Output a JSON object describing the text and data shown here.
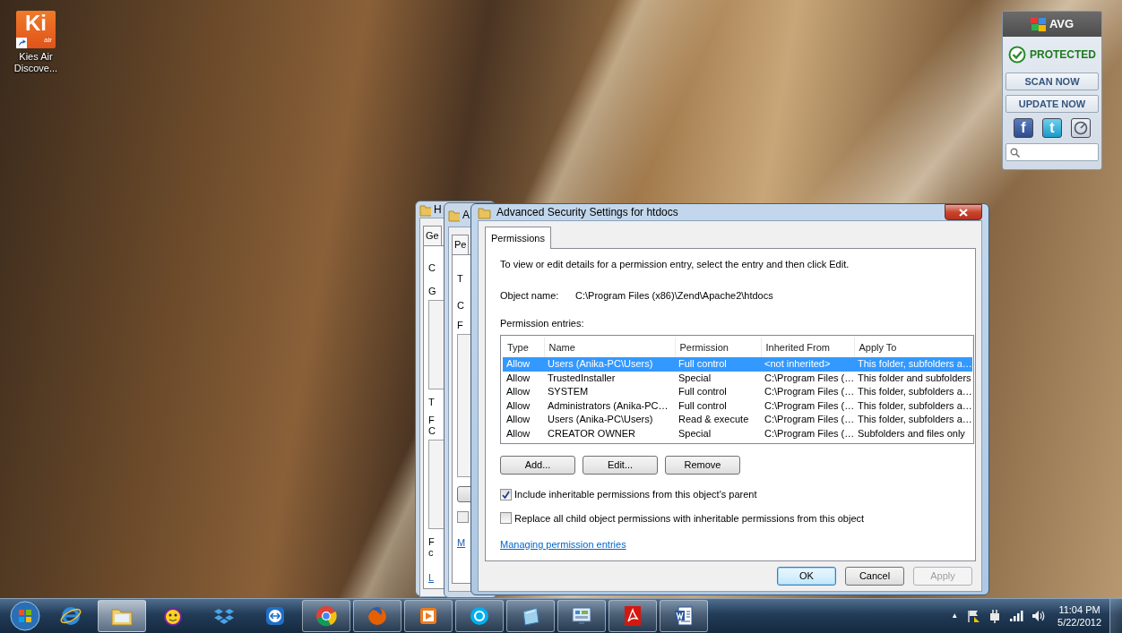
{
  "desktop_icons": [
    {
      "logo": "Ki",
      "logo_sub": "air",
      "label": "Kies Air Discove..."
    }
  ],
  "background_windows": [
    {
      "title": "H",
      "tab": "Ge",
      "lines": [
        {
          "kind": "text",
          "text": "C"
        },
        {
          "kind": "text",
          "text": "G"
        },
        {
          "kind": "listbox"
        },
        {
          "kind": "text",
          "text": "T"
        },
        {
          "kind": "text",
          "text": "F"
        },
        {
          "kind": "text",
          "text": "C"
        },
        {
          "kind": "listbox"
        },
        {
          "kind": "text",
          "text": "F"
        },
        {
          "kind": "text",
          "text": "c"
        },
        {
          "kind": "link",
          "text": "L"
        }
      ]
    },
    {
      "title": "A",
      "tab": "Pe",
      "lines": [
        {
          "kind": "text",
          "text": "T"
        },
        {
          "kind": "text",
          "text": "C"
        },
        {
          "kind": "text",
          "text": "F"
        },
        {
          "kind": "listbox"
        },
        {
          "kind": "button"
        },
        {
          "kind": "checkbox",
          "checked": false
        },
        {
          "kind": "link",
          "text": "M"
        }
      ]
    }
  ],
  "dialog": {
    "title": "Advanced Security Settings for htdocs",
    "tabs": [
      {
        "label": "Permissions",
        "selected": true
      }
    ],
    "instructions": "To view or edit details for a permission entry, select the entry and then click Edit.",
    "object_name_label": "Object name:",
    "object_name": "C:\\Program Files (x86)\\Zend\\Apache2\\htdocs",
    "entries_label": "Permission entries:",
    "columns": [
      "Type",
      "Name",
      "Permission",
      "Inherited From",
      "Apply To"
    ],
    "rows": [
      {
        "cells": [
          "Allow",
          "Users (Anika-PC\\Users)",
          "Full control",
          "<not inherited>",
          "This folder, subfolders a…"
        ],
        "selected": true
      },
      {
        "cells": [
          "Allow",
          "TrustedInstaller",
          "Special",
          "C:\\Program Files (…",
          "This folder and subfolders"
        ],
        "selected": false
      },
      {
        "cells": [
          "Allow",
          "SYSTEM",
          "Full control",
          "C:\\Program Files (…",
          "This folder, subfolders a…"
        ],
        "selected": false
      },
      {
        "cells": [
          "Allow",
          "Administrators (Anika-PC…",
          "Full control",
          "C:\\Program Files (…",
          "This folder, subfolders a…"
        ],
        "selected": false
      },
      {
        "cells": [
          "Allow",
          "Users (Anika-PC\\Users)",
          "Read & execute",
          "C:\\Program Files (…",
          "This folder, subfolders a…"
        ],
        "selected": false
      },
      {
        "cells": [
          "Allow",
          "CREATOR OWNER",
          "Special",
          "C:\\Program Files (…",
          "Subfolders and files only"
        ],
        "selected": false
      }
    ],
    "entry_buttons": [
      "Add...",
      "Edit...",
      "Remove"
    ],
    "options": [
      {
        "label": "Include inheritable permissions from this object's parent",
        "checked": true
      },
      {
        "label": "Replace all child object permissions with inheritable permissions from this object",
        "checked": false
      }
    ],
    "help_link": "Managing permission entries",
    "buttons": [
      {
        "label": "OK",
        "default": true,
        "disabled": false
      },
      {
        "label": "Cancel",
        "default": false,
        "disabled": false
      },
      {
        "label": "Apply",
        "default": false,
        "disabled": true
      }
    ]
  },
  "avg_widget": {
    "logo": "AVG",
    "status": "PROTECTED",
    "buttons": [
      "SCAN NOW",
      "UPDATE NOW"
    ],
    "social": [
      {
        "kind": "facebook",
        "glyph": "f"
      },
      {
        "kind": "twitter",
        "glyph": "t"
      },
      {
        "kind": "gauge"
      }
    ]
  },
  "taskbar": {
    "items": [
      {
        "kind": "ie",
        "open": false,
        "selected": false
      },
      {
        "kind": "folder",
        "open": true,
        "selected": true
      },
      {
        "kind": "messenger",
        "open": false,
        "selected": false
      },
      {
        "kind": "dropbox",
        "open": false,
        "selected": false
      },
      {
        "kind": "remote",
        "open": false,
        "selected": false
      },
      {
        "kind": "chrome",
        "open": true,
        "selected": false
      },
      {
        "kind": "firefox",
        "open": true,
        "selected": false
      },
      {
        "kind": "media",
        "open": true,
        "selected": false
      },
      {
        "kind": "skype",
        "open": true,
        "selected": false
      },
      {
        "kind": "glass",
        "open": true,
        "selected": false
      },
      {
        "kind": "panel",
        "open": true,
        "selected": false
      },
      {
        "kind": "pdf",
        "open": true,
        "selected": false
      },
      {
        "kind": "word",
        "open": true,
        "selected": false
      }
    ],
    "tray": {
      "show_hidden": "▲",
      "time": "11:04 PM",
      "date": "5/22/2012"
    }
  }
}
